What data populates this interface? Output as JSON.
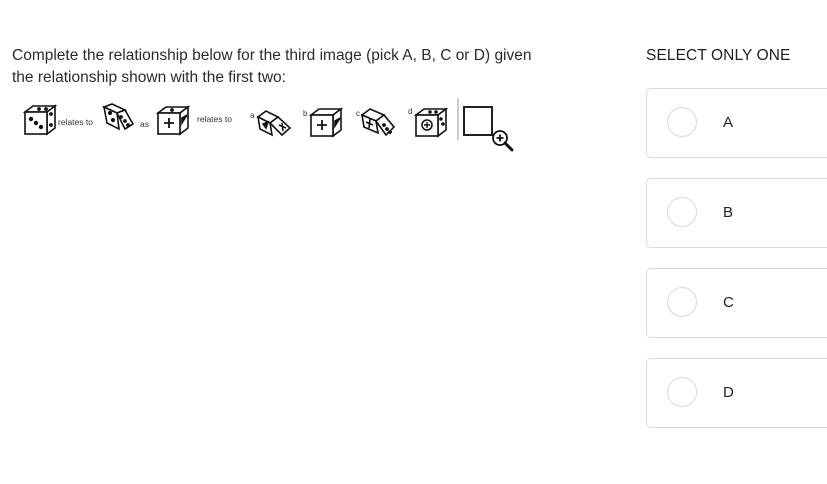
{
  "question": {
    "text": "Complete the relationship below for the third image (pick A, B, C or D) given the relationship shown with the first two:"
  },
  "figure": {
    "relates_to_1": "relates to",
    "as": "as",
    "relates_to_2": "relates to",
    "option_letters": [
      "a",
      "b",
      "c",
      "d"
    ],
    "zoom_icon": "zoom-in-icon"
  },
  "answer_panel": {
    "title": "SELECT ONLY ONE",
    "options": [
      {
        "label": "A"
      },
      {
        "label": "B"
      },
      {
        "label": "C"
      },
      {
        "label": "D"
      }
    ]
  }
}
